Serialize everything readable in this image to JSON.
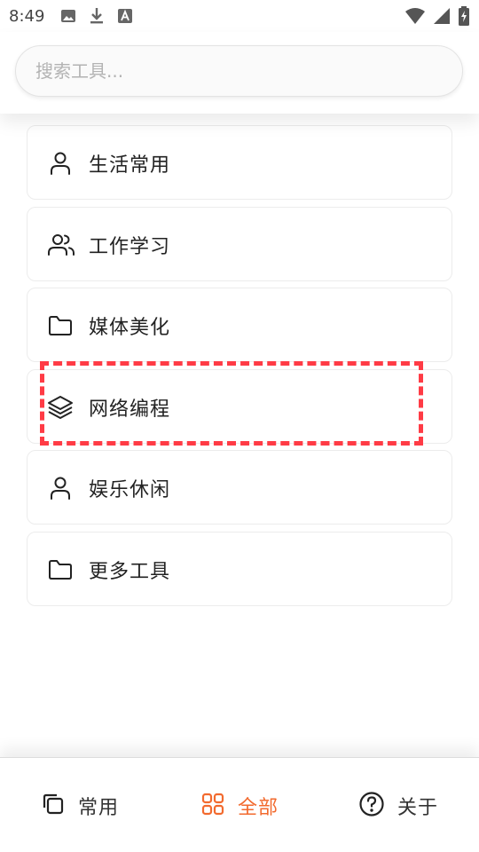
{
  "status_bar": {
    "time": "8:49",
    "icons_left": [
      "image-icon",
      "download-icon",
      "font-a-icon"
    ],
    "icons_right": [
      "wifi-icon",
      "signal-icon",
      "battery-charging-icon"
    ]
  },
  "search": {
    "placeholder": "搜索工具...",
    "value": ""
  },
  "categories": [
    {
      "label": "生活常用",
      "icon": "user-icon"
    },
    {
      "label": "工作学习",
      "icon": "users-icon"
    },
    {
      "label": "媒体美化",
      "icon": "folder-icon"
    },
    {
      "label": "网络编程",
      "icon": "layers-icon"
    },
    {
      "label": "娱乐休闲",
      "icon": "user-icon"
    },
    {
      "label": "更多工具",
      "icon": "folder-icon"
    }
  ],
  "bottom_nav": {
    "items": [
      {
        "label": "常用",
        "icon": "copy-icon",
        "active": false
      },
      {
        "label": "全部",
        "icon": "grid-icon",
        "active": true
      },
      {
        "label": "关于",
        "icon": "help-circle-icon",
        "active": false
      }
    ],
    "active_color": "#f26a2e",
    "inactive_color": "#333333"
  },
  "highlight_color": "#ff3b45"
}
